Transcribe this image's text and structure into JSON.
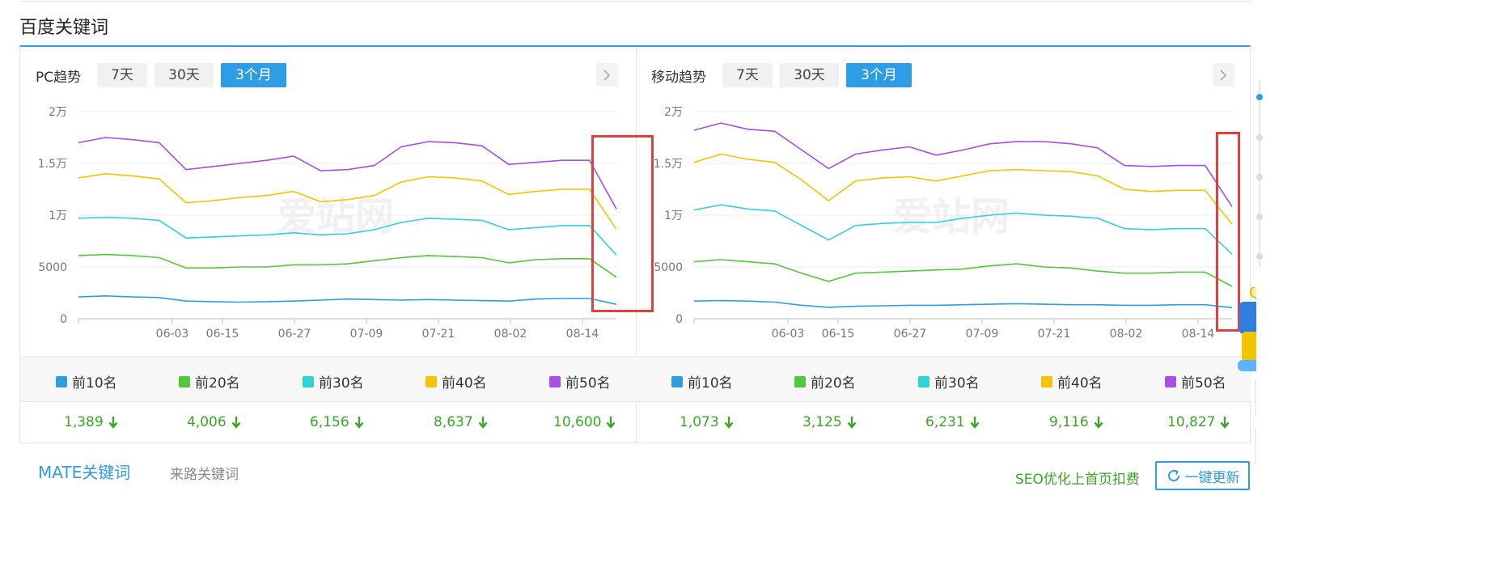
{
  "section_title": "百度关键词",
  "colors": {
    "accent": "#2f9de4",
    "top10": "#2f9de4",
    "top20": "#52c93a",
    "top30": "#2ed3d6",
    "top40": "#f8c300",
    "top50": "#a64ee6",
    "down": "#3aa624",
    "highlight": "#e0403e"
  },
  "tabs": [
    "7天",
    "30天",
    "3个月"
  ],
  "active_tab": "3个月",
  "panels": [
    {
      "title": "PC趋势",
      "legend": [
        "前10名",
        "前20名",
        "前30名",
        "前40名",
        "前50名"
      ],
      "values": [
        "1,389",
        "4,006",
        "6,156",
        "8,637",
        "10,600"
      ]
    },
    {
      "title": "移动趋势",
      "legend": [
        "前10名",
        "前20名",
        "前30名",
        "前40名",
        "前50名"
      ],
      "values": [
        "1,073",
        "3,125",
        "6,231",
        "9,116",
        "10,827"
      ]
    }
  ],
  "chart_data": [
    {
      "type": "line",
      "title": "PC趋势",
      "y_tick_labels": [
        "0",
        "5000",
        "1万",
        "1.5万",
        "2万"
      ],
      "ylim": [
        0,
        20000
      ],
      "x_tick_labels": [
        "06-03",
        "06-15",
        "06-27",
        "07-09",
        "07-21",
        "08-02",
        "08-14"
      ],
      "series": [
        {
          "name": "前10名",
          "color": "#2f9de4",
          "values": [
            2100,
            2200,
            2100,
            2050,
            1700,
            1650,
            1600,
            1650,
            1700,
            1800,
            1900,
            1850,
            1800,
            1850,
            1800,
            1750,
            1700,
            1900,
            1950,
            1950,
            1389
          ]
        },
        {
          "name": "前20名",
          "color": "#52c93a",
          "values": [
            6100,
            6200,
            6100,
            5900,
            4900,
            4900,
            5000,
            5000,
            5200,
            5200,
            5300,
            5600,
            5900,
            6100,
            6000,
            5900,
            5400,
            5700,
            5800,
            5800,
            4006
          ]
        },
        {
          "name": "前30名",
          "color": "#2ed3d6",
          "values": [
            9700,
            9800,
            9700,
            9500,
            7800,
            7900,
            8000,
            8100,
            8300,
            8100,
            8200,
            8600,
            9300,
            9700,
            9600,
            9500,
            8600,
            8800,
            9000,
            9000,
            6156
          ]
        },
        {
          "name": "前40名",
          "color": "#f8c300",
          "values": [
            13600,
            14000,
            13800,
            13500,
            11200,
            11400,
            11700,
            11900,
            12300,
            11300,
            11500,
            11900,
            13200,
            13700,
            13600,
            13300,
            12000,
            12300,
            12500,
            12500,
            8637
          ]
        },
        {
          "name": "前50名",
          "color": "#a64ee6",
          "values": [
            17000,
            17500,
            17300,
            17000,
            14400,
            14700,
            15000,
            15300,
            15700,
            14300,
            14400,
            14800,
            16600,
            17100,
            17000,
            16700,
            14900,
            15100,
            15300,
            15300,
            10600
          ]
        }
      ]
    },
    {
      "type": "line",
      "title": "移动趋势",
      "y_tick_labels": [
        "0",
        "5000",
        "1万",
        "1.5万",
        "2万"
      ],
      "ylim": [
        0,
        20000
      ],
      "x_tick_labels": [
        "06-03",
        "06-15",
        "06-27",
        "07-09",
        "07-21",
        "08-02",
        "08-14"
      ],
      "series": [
        {
          "name": "前10名",
          "color": "#2f9de4",
          "values": [
            1700,
            1750,
            1700,
            1600,
            1300,
            1100,
            1200,
            1250,
            1300,
            1300,
            1350,
            1400,
            1450,
            1400,
            1350,
            1350,
            1300,
            1300,
            1350,
            1350,
            1073
          ]
        },
        {
          "name": "前20名",
          "color": "#52c93a",
          "values": [
            5500,
            5700,
            5500,
            5300,
            4400,
            3600,
            4400,
            4500,
            4600,
            4700,
            4800,
            5100,
            5300,
            5000,
            4900,
            4600,
            4400,
            4400,
            4500,
            4500,
            3125
          ]
        },
        {
          "name": "前30名",
          "color": "#2ed3d6",
          "values": [
            10500,
            11000,
            10600,
            10400,
            9000,
            7600,
            9000,
            9200,
            9300,
            9300,
            9700,
            10000,
            10200,
            10000,
            9900,
            9700,
            8700,
            8600,
            8700,
            8700,
            6231
          ]
        },
        {
          "name": "前40名",
          "color": "#f8c300",
          "values": [
            15100,
            15900,
            15400,
            15100,
            13400,
            11400,
            13300,
            13600,
            13700,
            13300,
            13800,
            14300,
            14400,
            14300,
            14200,
            13800,
            12500,
            12300,
            12400,
            12400,
            9116
          ]
        },
        {
          "name": "前50名",
          "color": "#a64ee6",
          "values": [
            18200,
            18900,
            18300,
            18100,
            16300,
            14500,
            15900,
            16300,
            16600,
            15800,
            16300,
            16900,
            17100,
            17100,
            16900,
            16500,
            14800,
            14700,
            14800,
            14800,
            10827
          ]
        }
      ]
    }
  ],
  "bottom_tabs": [
    "MATE关键词",
    "来路关键词"
  ],
  "seo_link": "SEO优化上首页扣费",
  "refresh_label": "一键更新",
  "watermark": "爱站网"
}
